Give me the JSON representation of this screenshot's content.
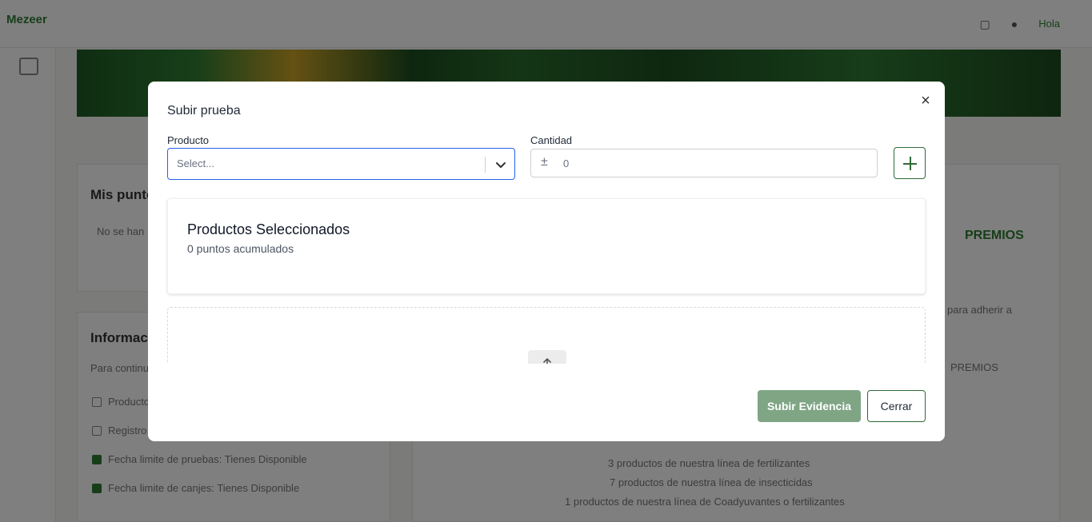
{
  "background": {
    "logo": "Mezeer",
    "nav_user": "Hola",
    "card_left_title": "Mis puntos",
    "card_left_text": "No se han",
    "card_left2_title": "Informacion",
    "card_left2_text": "Para continuar",
    "checklist": [
      {
        "label": "Productos",
        "checked": false
      },
      {
        "label": "Registro",
        "checked": false
      },
      {
        "label": "Fecha limite de pruebas: Tienes Disponible",
        "checked": true
      },
      {
        "label": "Fecha limite de canjes: Tienes Disponible",
        "checked": true
      }
    ],
    "right_heading": "PREMIOS",
    "right_line1": "para adherir a",
    "right_line2": "PREMIOS",
    "right_rules": [
      "3 productos de nuestra línea de fertilizantes",
      "7 productos de nuestra línea de insecticidas",
      "1 productos de nuestra línea de Coadyuvantes o fertilizantes"
    ]
  },
  "modal": {
    "title": "Subir prueba",
    "close_symbol": "×",
    "producto_label": "Producto",
    "producto_placeholder": "Select...",
    "cantidad_label": "Cantidad",
    "cantidad_icon": "±",
    "cantidad_value": "0",
    "selected_title": "Productos Seleccionados",
    "selected_points": "0 puntos acumulados",
    "submit_label": "Subir Evidencia",
    "close_label": "Cerrar"
  },
  "colors": {
    "accent_green": "#2e6b3a",
    "submit_button": "#7fa585",
    "focus_border": "#2563eb"
  }
}
